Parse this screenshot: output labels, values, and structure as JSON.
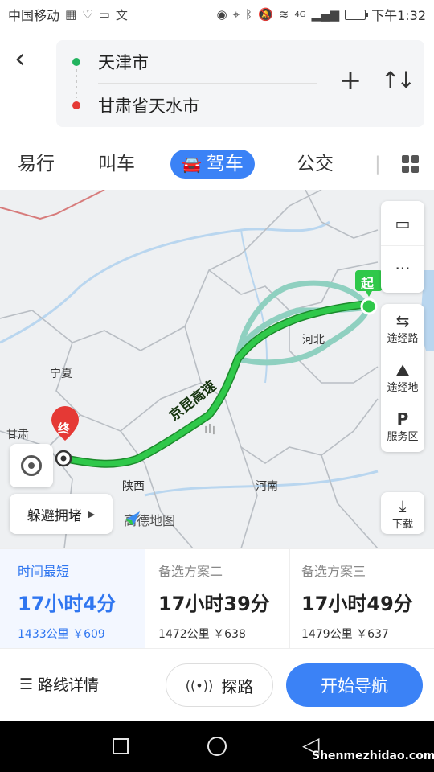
{
  "status_bar": {
    "carrier": "中国移动",
    "network": "4G",
    "battery_level": 0.25,
    "time": "下午1:32"
  },
  "route": {
    "start": "天津市",
    "end": "甘肃省天水市",
    "start_color": "#22b35e",
    "end_color": "#e53935"
  },
  "modes": {
    "tabs": [
      "易行",
      "叫车",
      "驾车",
      "公交"
    ],
    "active": "驾车",
    "active_color": "#3b82f6"
  },
  "map": {
    "labels": {
      "ningxia": "宁夏",
      "gansu": "甘肃",
      "hebei": "河北",
      "shaanxi": "陕西",
      "henan": "河南",
      "shan": "山",
      "highway": "京昆高速"
    },
    "start_marker": "起",
    "end_marker": "终",
    "side_buttons": {
      "waypoint_road": "途经路",
      "waypoint_place": "途经地",
      "service_area": "服务区",
      "download": "下载"
    },
    "avoid_congestion": "躲避拥堵",
    "brand": "高德地图",
    "route_color": "#2fc84a",
    "alt_route_color": "#8fd0c0"
  },
  "plans": [
    {
      "tag": "时间最短",
      "time": "17小时4分",
      "distance": "1433公里",
      "cost": "￥609",
      "selected": true
    },
    {
      "tag": "备选方案二",
      "time": "17小时39分",
      "distance": "1472公里",
      "cost": "￥638",
      "selected": false
    },
    {
      "tag": "备选方案三",
      "time": "17小时49分",
      "distance": "1479公里",
      "cost": "￥637",
      "selected": false
    }
  ],
  "actions": {
    "route_detail": "路线详情",
    "probe": "探路",
    "start_navigation": "开始导航"
  },
  "watermark": "Shenmezhidao.com"
}
